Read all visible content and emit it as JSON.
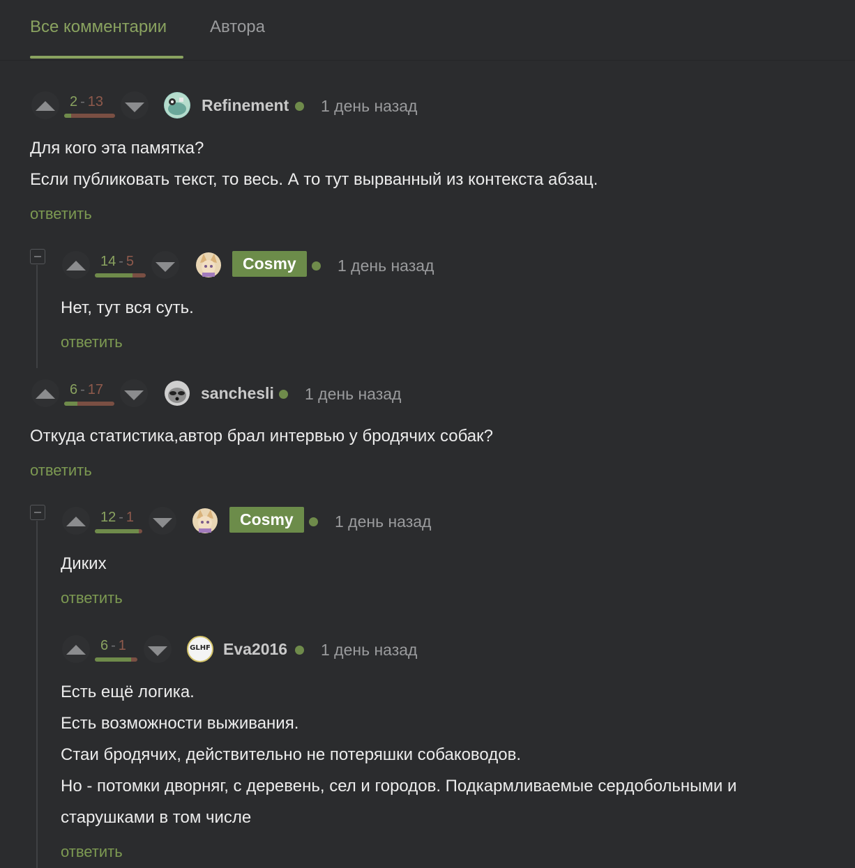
{
  "tabs": {
    "all": "Все комментарии",
    "author": "Автора"
  },
  "comments": [
    {
      "plus": "2",
      "minus": "13",
      "ratio": 0.133,
      "nick": "Refinement",
      "time": "1 день назад",
      "lines": [
        "Для кого эта памятка?",
        "Если публиковать текст, то весь. А то тут вырванный из контекста абзац."
      ],
      "reply": "ответить"
    },
    {
      "plus": "14",
      "minus": "5",
      "ratio": 0.737,
      "nick": "Cosmy",
      "time": "1 день назад",
      "lines": [
        "Нет, тут вся суть."
      ],
      "reply": "ответить"
    },
    {
      "plus": "6",
      "minus": "17",
      "ratio": 0.261,
      "nick": "sanchesli",
      "time": "1 день назад",
      "lines": [
        "Откуда статистика,автор брал интервью у бродячих собак?"
      ],
      "reply": "ответить"
    },
    {
      "plus": "12",
      "minus": "1",
      "ratio": 0.923,
      "nick": "Cosmy",
      "time": "1 день назад",
      "lines": [
        "Диких"
      ],
      "reply": "ответить"
    },
    {
      "plus": "6",
      "minus": "1",
      "ratio": 0.857,
      "nick": "Eva2016",
      "time": "1 день назад",
      "avatar_text": "GLHF",
      "lines": [
        "Есть ещё логика.",
        "Есть возможности выживания.",
        "Стаи бродячих, действительно не потеряшки собаководов.",
        "Но - потомки дворняг, с деревень, сел и городов. Подкармливаемые сердобольными и",
        "старушками в том числе"
      ],
      "reply": "ответить"
    }
  ],
  "colors": {
    "accent": "#8aa360",
    "minus": "#8f5a4c",
    "badge": "#6c8c4a",
    "background": "#2b2c2e"
  }
}
